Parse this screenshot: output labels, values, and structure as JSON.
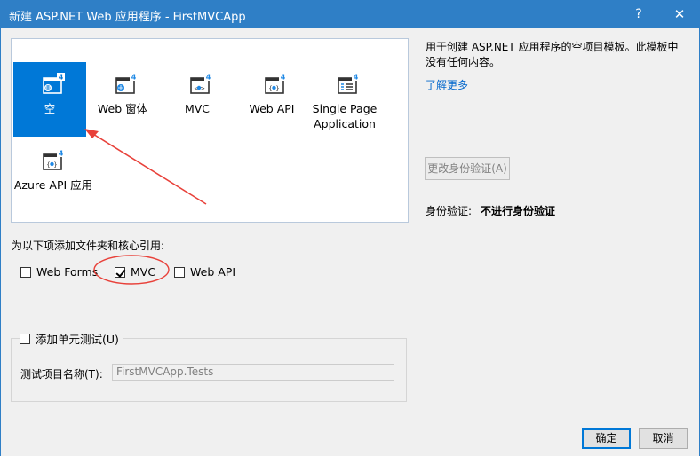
{
  "window": {
    "title": "新建 ASP.NET Web 应用程序 - FirstMVCApp",
    "help_glyph": "?",
    "close_glyph": "✕"
  },
  "templates": [
    {
      "label": "空",
      "icon": "empty-template-icon",
      "selected": true
    },
    {
      "label": "Web 窗体",
      "icon": "web-forms-template-icon",
      "selected": false
    },
    {
      "label": "MVC",
      "icon": "mvc-template-icon",
      "selected": false
    },
    {
      "label": "Web API",
      "icon": "web-api-template-icon",
      "selected": false
    },
    {
      "label": "Single Page Application",
      "icon": "spa-template-icon",
      "selected": false
    },
    {
      "label": "Azure API 应用",
      "icon": "azure-api-template-icon",
      "selected": false
    }
  ],
  "description": {
    "text": "用于创建 ASP.NET 应用程序的空项目模板。此模板中没有任何内容。",
    "learn_more": "了解更多"
  },
  "auth": {
    "change_button": "更改身份验证(A)",
    "label": "身份验证:",
    "value": "不进行身份验证"
  },
  "references": {
    "label": "为以下项添加文件夹和核心引用:",
    "options": [
      {
        "label": "Web Forms",
        "checked": false
      },
      {
        "label": "MVC",
        "checked": true
      },
      {
        "label": "Web API",
        "checked": false
      }
    ]
  },
  "unit_test": {
    "label": "添加单元测试(U)",
    "checked": false,
    "project_name_label": "测试项目名称(T):",
    "project_name_value": "FirstMVCApp.Tests"
  },
  "buttons": {
    "ok": "确定",
    "cancel": "取消"
  },
  "icon_badge": "4",
  "colors": {
    "titlebar": "#2f7fc6",
    "selection": "#0078d7",
    "annotation": "#e8413a",
    "link": "#0066cc"
  }
}
